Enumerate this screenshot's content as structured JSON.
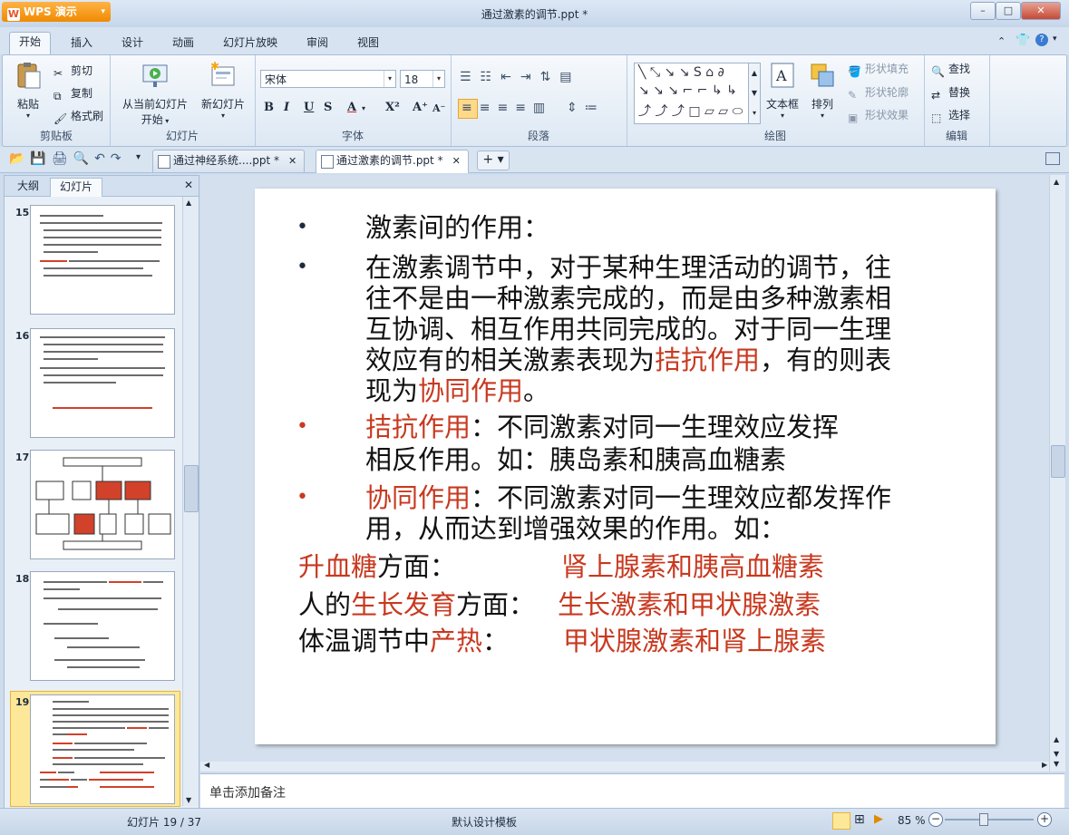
{
  "window": {
    "app_name": "WPS 演示",
    "title": "通过激素的调节.ppt *",
    "buttons": [
      "–",
      "□",
      "✕"
    ]
  },
  "ribbon_tabs": [
    "开始",
    "插入",
    "设计",
    "动画",
    "幻灯片放映",
    "审阅",
    "视图"
  ],
  "active_tab": "开始",
  "ribbon": {
    "clipboard": {
      "paste": "粘贴",
      "cut": "剪切",
      "copy": "复制",
      "format_painter": "格式刷",
      "label": "剪贴板"
    },
    "slides": {
      "from_current": "从当前幻灯片",
      "start": "开始",
      "new_slide": "新幻灯片",
      "label": "幻灯片"
    },
    "font": {
      "name": "宋体",
      "size": "18",
      "label": "字体"
    },
    "paragraph": {
      "label": "段落"
    },
    "drawing": {
      "textbox": "文本框",
      "arrange": "排列",
      "shape_fill": "形状填充",
      "shape_outline": "形状轮廓",
      "shape_effect": "形状效果",
      "label": "绘图"
    },
    "editing": {
      "find": "查找",
      "replace": "替换",
      "select": "选择",
      "label": "编辑"
    }
  },
  "doc_tabs": [
    {
      "label": "通过神经系统....ppt *"
    },
    {
      "label": "通过激素的调节.ppt *"
    }
  ],
  "left_pane": {
    "tabs": [
      "大纲",
      "幻灯片"
    ],
    "slide_numbers": [
      "15",
      "16",
      "17",
      "18",
      "19"
    ]
  },
  "slide": {
    "lines": [
      {
        "parts": [
          {
            "t": "激素间的作用：",
            "c": "black"
          }
        ]
      },
      {
        "parts": [
          {
            "t": "在激素调节中，对于某种生理活动的调节，往",
            "c": "black"
          }
        ]
      },
      {
        "parts": [
          {
            "t": "往不是由一种激素完成的，而是由多种激素相",
            "c": "black"
          }
        ]
      },
      {
        "parts": [
          {
            "t": "互协调、相互作用共同完成的。对于同一生理",
            "c": "black"
          }
        ]
      },
      {
        "parts": [
          {
            "t": "效应有的相关激素表现为",
            "c": "black"
          },
          {
            "t": "拮抗作用",
            "c": "red"
          },
          {
            "t": "，有的则表",
            "c": "black"
          }
        ]
      },
      {
        "parts": [
          {
            "t": "现为",
            "c": "black"
          },
          {
            "t": "协同作用",
            "c": "red"
          },
          {
            "t": "。",
            "c": "black"
          }
        ]
      },
      {
        "parts": [
          {
            "t": "拮抗作用",
            "c": "red"
          },
          {
            "t": "：不同激素对同一生理效应发挥",
            "c": "black"
          }
        ]
      },
      {
        "parts": [
          {
            "t": "相反作用。如：胰岛素和胰高血糖素",
            "c": "black"
          }
        ]
      },
      {
        "parts": [
          {
            "t": "协同作用",
            "c": "red"
          },
          {
            "t": "：不同激素对同一生理效应都发挥作",
            "c": "black"
          }
        ]
      },
      {
        "parts": [
          {
            "t": "用，从而达到增强效果的作用。如：",
            "c": "black"
          }
        ]
      },
      {
        "parts": [
          {
            "t": "升血糖",
            "c": "red"
          },
          {
            "t": "方面：",
            "c": "black"
          },
          {
            "t": "肾上腺素和胰高血糖素",
            "c": "red"
          }
        ]
      },
      {
        "parts": [
          {
            "t": "人的",
            "c": "black"
          },
          {
            "t": "生长发育",
            "c": "red"
          },
          {
            "t": "方面：",
            "c": "black"
          },
          {
            "t": "生长激素和甲状腺激素",
            "c": "red"
          }
        ]
      },
      {
        "parts": [
          {
            "t": "体温调节中",
            "c": "black"
          },
          {
            "t": "产热",
            "c": "red"
          },
          {
            "t": "：",
            "c": "black"
          },
          {
            "t": "甲状腺激素和肾上腺素",
            "c": "red"
          }
        ]
      }
    ],
    "bullets": [
      "•",
      "•",
      "•",
      "•"
    ]
  },
  "notes_placeholder": "单击添加备注",
  "status": {
    "slide_counter": "幻灯片 19 / 37",
    "template": "默认设计模板",
    "zoom": "85 %"
  },
  "colors": {
    "accent_red": "#c8391f",
    "ribbon_bg": "#dde8f4"
  }
}
